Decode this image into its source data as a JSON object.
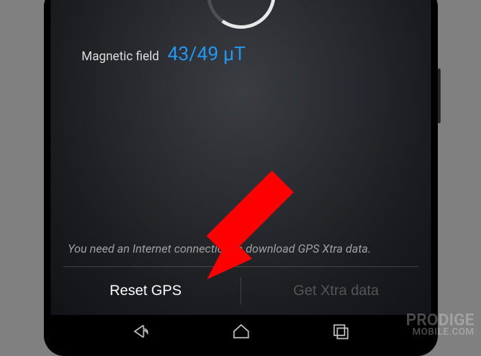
{
  "magnetic": {
    "label": "Magnetic field",
    "value": "43/49 μT"
  },
  "info_text": "You need an Internet connection to download GPS Xtra data.",
  "buttons": {
    "reset": "Reset GPS",
    "xtra": "Get Xtra data"
  },
  "watermark": {
    "line1": "PRODIGE",
    "line2": "MOBILE.COM"
  }
}
